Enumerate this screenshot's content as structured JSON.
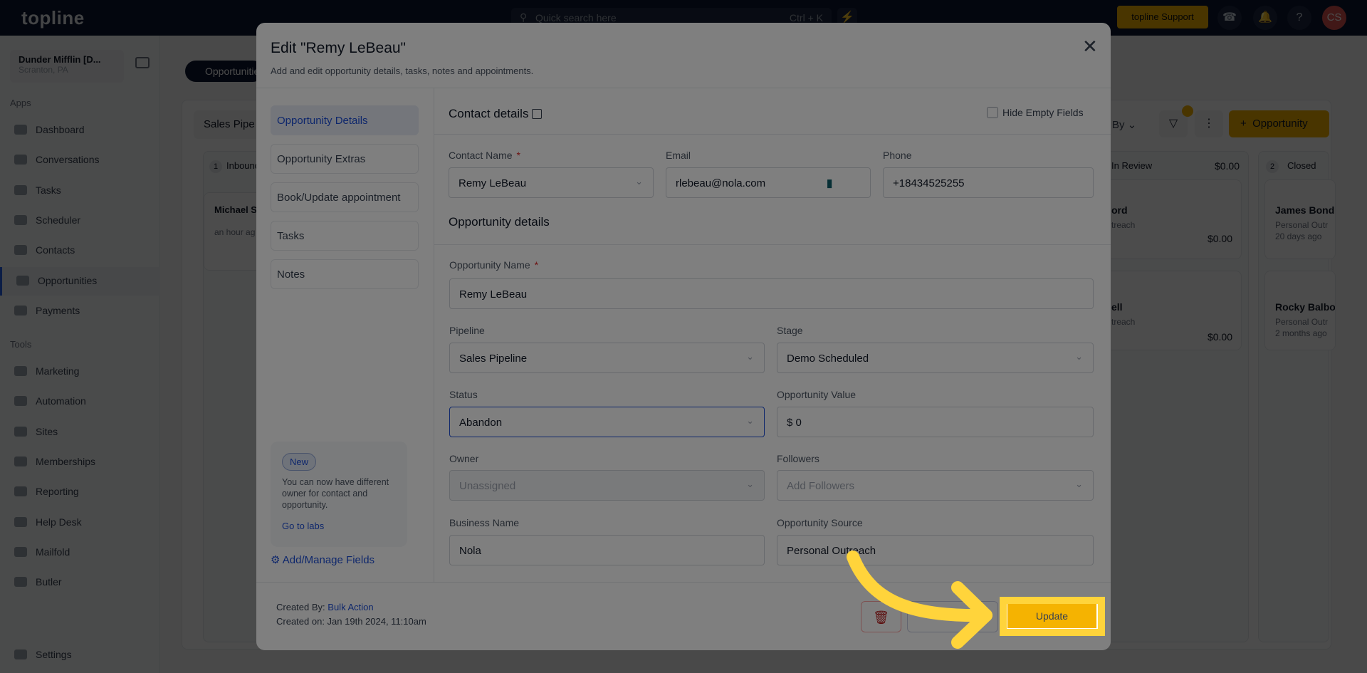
{
  "topbar": {
    "logo": "topline",
    "search_placeholder": "Quick search here",
    "search_shortcut": "Ctrl + K",
    "support": "topline Support",
    "avatar": "CS"
  },
  "sidebar": {
    "account_name": "Dunder Mifflin [D...",
    "account_location": "Scranton, PA",
    "apps_label": "Apps",
    "tools_label": "Tools",
    "apps": [
      {
        "label": "Dashboard"
      },
      {
        "label": "Conversations"
      },
      {
        "label": "Tasks"
      },
      {
        "label": "Scheduler"
      },
      {
        "label": "Contacts"
      },
      {
        "label": "Opportunities",
        "active": true
      },
      {
        "label": "Payments"
      }
    ],
    "tools": [
      {
        "label": "Marketing"
      },
      {
        "label": "Automation"
      },
      {
        "label": "Sites"
      },
      {
        "label": "Memberships"
      },
      {
        "label": "Reporting"
      },
      {
        "label": "Help Desk"
      },
      {
        "label": "Mailfold"
      },
      {
        "label": "Butler"
      }
    ],
    "settings": "Settings"
  },
  "board": {
    "tab": "Opportunities",
    "pipeline": "Sales Pipe",
    "sort": "By",
    "add_button": "Opportunity",
    "columns": [
      {
        "count": "1",
        "name": "Inbound",
        "cards": [
          {
            "name": "Michael S",
            "time": "an hour ag"
          }
        ]
      },
      {
        "name": "In Review",
        "total": "$0.00",
        "cards": [
          {
            "name": "ord",
            "source": "treach",
            "value": "$0.00"
          },
          {
            "name": "ell",
            "source": "treach",
            "value": "$0.00"
          }
        ]
      },
      {
        "count": "2",
        "name": "Closed",
        "cards": [
          {
            "name": "James Bond",
            "source": "Personal Outr",
            "time": "20 days ago"
          },
          {
            "name": "Rocky Balbo",
            "source": "Personal Outr",
            "time": "2 months ago"
          }
        ]
      }
    ]
  },
  "modal": {
    "title": "Edit \"Remy LeBeau\"",
    "subtitle": "Add and edit opportunity details, tasks, notes and appointments.",
    "tabs": [
      "Opportunity Details",
      "Opportunity Extras",
      "Book/Update appointment",
      "Tasks",
      "Notes"
    ],
    "notice": {
      "badge": "New",
      "text": "You can now have different owner for contact and opportunity.",
      "link": "Go to labs"
    },
    "manage_fields": "Add/Manage Fields",
    "contact_header": "Contact details",
    "hide_empty": "Hide Empty Fields",
    "hide_empty_checked": false,
    "contact": {
      "name_label": "Contact Name",
      "name": "Remy LeBeau",
      "email_label": "Email",
      "email": "rlebeau@nola.com",
      "phone_label": "Phone",
      "phone": "+18434525255"
    },
    "opp_header": "Opportunity details",
    "opp": {
      "name_label": "Opportunity Name",
      "name": "Remy LeBeau",
      "pipeline_label": "Pipeline",
      "pipeline": "Sales Pipeline",
      "stage_label": "Stage",
      "stage": "Demo Scheduled",
      "status_label": "Status",
      "status": "Abandon",
      "value_label": "Opportunity Value",
      "value": "$ 0",
      "owner_label": "Owner",
      "owner_placeholder": "Unassigned",
      "followers_label": "Followers",
      "followers_placeholder": "Add Followers",
      "business_label": "Business Name",
      "business": "Nola",
      "source_label": "Opportunity Source",
      "source": "Personal Outreach"
    },
    "footer": {
      "created_by_label": "Created By:",
      "created_by": "Bulk Action",
      "created_on": "Created on: Jan 19th 2024, 11:10am",
      "update": "Update"
    }
  },
  "colors": {
    "accent": "#f5b301",
    "highlight": "#ffd43b",
    "link": "#1d4ed8"
  }
}
